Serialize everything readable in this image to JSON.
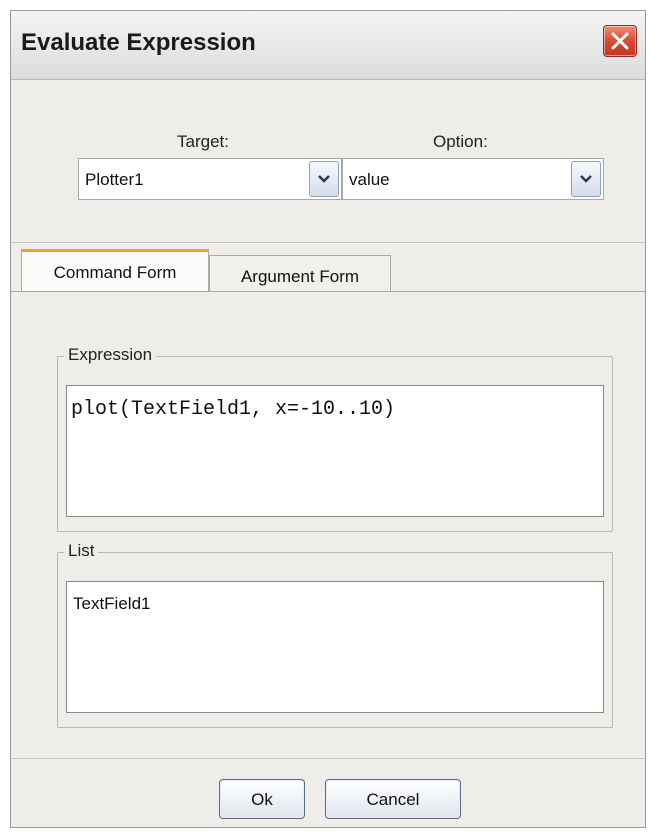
{
  "window": {
    "title": "Evaluate Expression"
  },
  "target": {
    "label": "Target:",
    "value": "Plotter1"
  },
  "option": {
    "label": "Option:",
    "value": "value"
  },
  "tabs": [
    {
      "label": "Command Form",
      "active": true
    },
    {
      "label": "Argument Form",
      "active": false
    }
  ],
  "expression": {
    "legend": "Expression",
    "value": "plot(TextField1, x=-10..10)"
  },
  "list": {
    "legend": "List",
    "items": [
      "TextField1"
    ]
  },
  "buttons": {
    "ok": "Ok",
    "cancel": "Cancel"
  },
  "colors": {
    "close_button": "#d9462f",
    "active_tab_accent": "#f0a030"
  },
  "icons": {
    "close": "close-icon",
    "dropdown": "chevron-down-icon"
  }
}
